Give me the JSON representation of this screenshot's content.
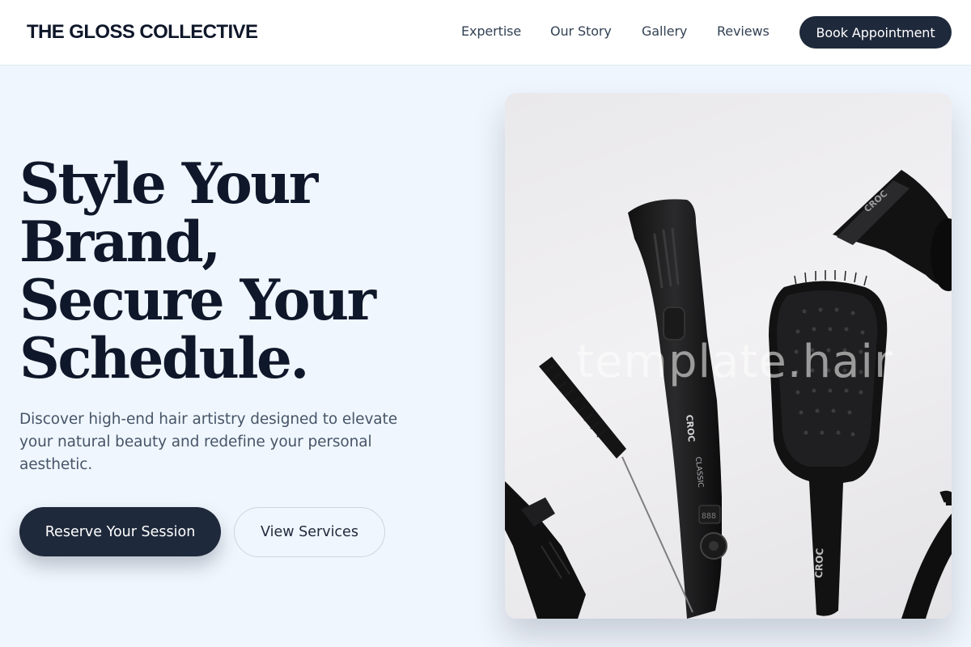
{
  "header": {
    "brand": "THE GLOSS COLLECTIVE",
    "nav": [
      {
        "label": "Expertise"
      },
      {
        "label": "Our Story"
      },
      {
        "label": "Gallery"
      },
      {
        "label": "Reviews"
      }
    ],
    "cta_label": "Book Appointment"
  },
  "hero": {
    "title_lines": [
      "Style Your",
      "Brand,",
      "Secure Your",
      "Schedule."
    ],
    "description": "Discover high-end hair artistry designed to elevate your natural beauty and redefine your personal aesthetic.",
    "primary_button": "Reserve Your Session",
    "secondary_button": "View Services"
  },
  "image": {
    "watermark": "template.hair",
    "brand_marks": [
      "CROC",
      "CLASSIC",
      "888"
    ]
  },
  "colors": {
    "page_background": "#f0f6fd",
    "primary_dark": "#1e293b",
    "heading": "#0f172a",
    "body_text": "#475569"
  }
}
